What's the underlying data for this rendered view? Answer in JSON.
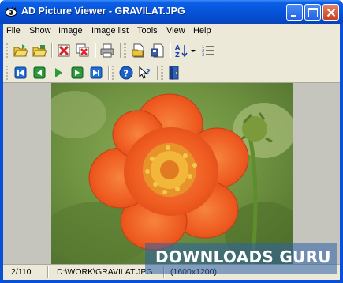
{
  "window": {
    "title": "AD Picture Viewer - GRAVILAT.JPG"
  },
  "menu": [
    "File",
    "Show",
    "Image",
    "Image list",
    "Tools",
    "View",
    "Help"
  ],
  "toolbar1": {
    "icons": [
      "open-folder-icon",
      "open-folder-icon",
      "delete-image-icon",
      "delete-list-icon",
      "print-icon",
      "page-setup-icon",
      "save-icon",
      "sort-az-icon",
      "dropdown-arrow-icon",
      "numbered-list-icon"
    ]
  },
  "toolbar2": {
    "icons": [
      "first-image-icon",
      "previous-image-icon",
      "play-slideshow-icon",
      "next-image-icon",
      "last-image-icon",
      "help-icon",
      "context-help-icon",
      "exit-icon"
    ]
  },
  "status": {
    "index": "2/110",
    "path": "D:\\WORK\\GRAVILAT.JPG",
    "dimensions": "(1600x1200)"
  },
  "watermark": {
    "text": "DOWNLOADS GURU"
  },
  "colors": {
    "titlebar": "#0654d8",
    "chrome": "#ece9d8",
    "petal": "#f06026",
    "close": "#c8401e"
  }
}
